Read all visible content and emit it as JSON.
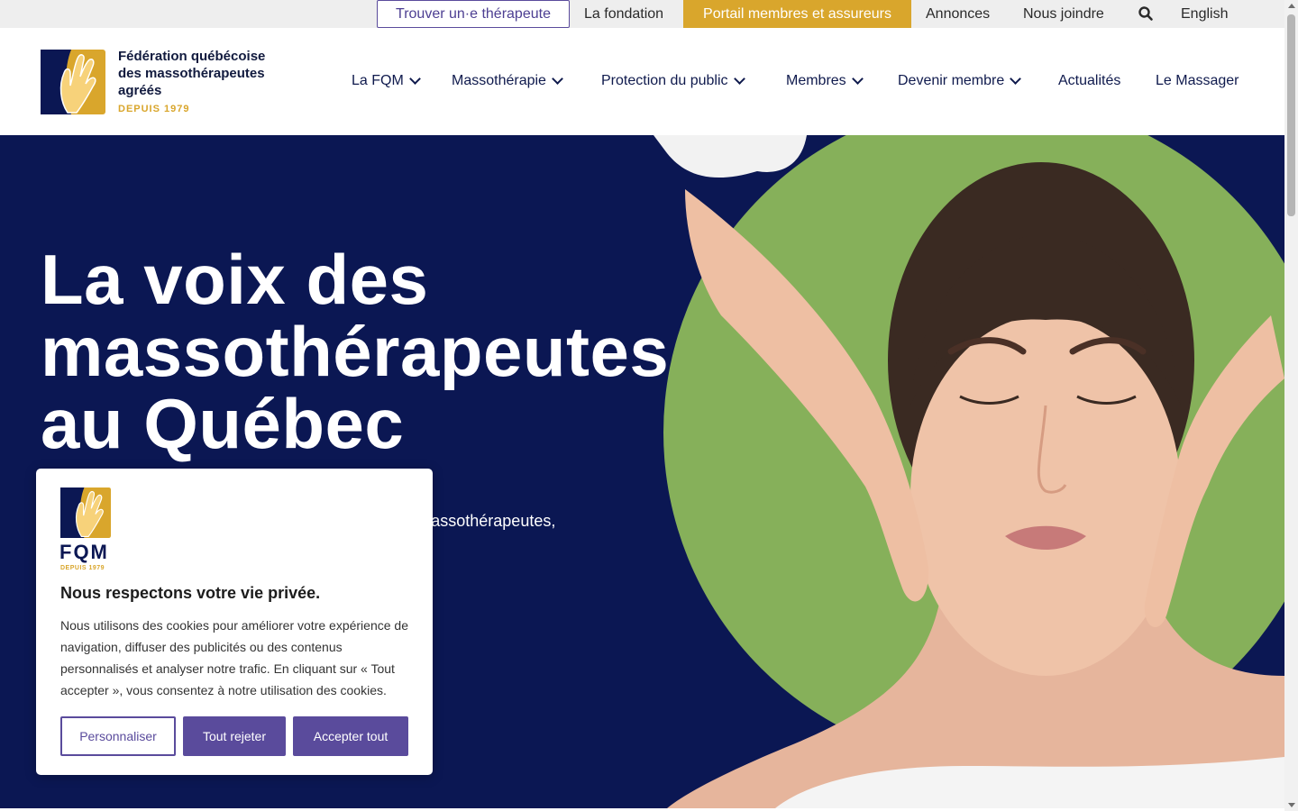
{
  "topbar": {
    "find_therapist": "Trouver un·e thérapeute",
    "foundation": "La fondation",
    "portal": "Portail membres et assureurs",
    "ads": "Annonces",
    "contact": "Nous joindre",
    "search_icon": "search-icon",
    "language": "English"
  },
  "header": {
    "logo_text": "Fédération québécoise des massothérapeutes agréés",
    "logo_since": "DEPUIS 1979",
    "nav": [
      {
        "label": "La FQM",
        "has_dropdown": true
      },
      {
        "label": "Massothérapie",
        "has_dropdown": true
      },
      {
        "label": "Protection du public",
        "has_dropdown": true
      },
      {
        "label": "Membres",
        "has_dropdown": true
      },
      {
        "label": "Devenir membre",
        "has_dropdown": true
      },
      {
        "label": "Actualités",
        "has_dropdown": false
      },
      {
        "label": "Le Massager",
        "has_dropdown": false
      }
    ]
  },
  "hero": {
    "title": "La voix des massothérapeutes au Québec",
    "text": "thérapeutes agréés es dans leur e public. Elle est la massothérapeutes,"
  },
  "cookie": {
    "logo_text": "FQM",
    "logo_since": "DEPUIS 1979",
    "title": "Nous respectons votre vie privée.",
    "text": "Nous utilisons des cookies pour améliorer votre expérience de navigation, diffuser des publicités ou des contenus personnalisés et analyser notre trafic. En cliquant sur « Tout accepter », vous consentez à notre utilisation des cookies.",
    "customize": "Personnaliser",
    "reject": "Tout rejeter",
    "accept": "Accepter tout"
  },
  "colors": {
    "navy": "#0b1753",
    "gold": "#d9a62c",
    "purple": "#5a4b9c",
    "green": "#86b05a"
  }
}
